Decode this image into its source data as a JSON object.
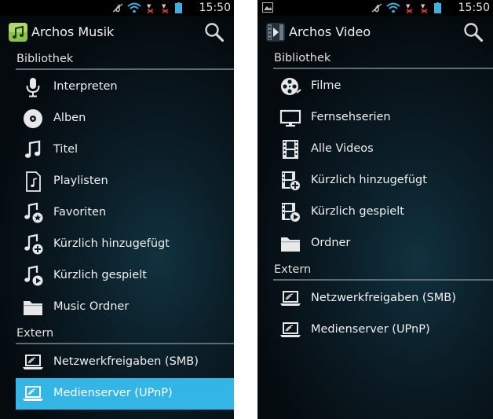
{
  "status": {
    "time": "15:50"
  },
  "left": {
    "app_title": "Archos Musik",
    "sections": [
      {
        "label": "Bibliothek",
        "items": [
          {
            "label": "Interpreten",
            "icon": "microphone-icon"
          },
          {
            "label": "Alben",
            "icon": "disc-icon"
          },
          {
            "label": "Titel",
            "icon": "music-note-icon"
          },
          {
            "label": "Playlisten",
            "icon": "playlist-file-icon"
          },
          {
            "label": "Favoriten",
            "icon": "note-star-icon"
          },
          {
            "label": "Kürzlich hinzugefügt",
            "icon": "note-plus-icon"
          },
          {
            "label": "Kürzlich gespielt",
            "icon": "note-play-icon"
          },
          {
            "label": "Music Ordner",
            "icon": "folder-icon"
          }
        ]
      },
      {
        "label": "Extern",
        "items": [
          {
            "label": "Netzwerkfreigaben (SMB)",
            "icon": "laptop-network-icon"
          },
          {
            "label": "Medienserver (UPnP)",
            "icon": "laptop-network-icon",
            "selected": true
          }
        ]
      }
    ]
  },
  "right": {
    "app_title": "Archos Video",
    "sections": [
      {
        "label": "Bibliothek",
        "items": [
          {
            "label": "Filme",
            "icon": "film-reel-icon"
          },
          {
            "label": "Fernsehserien",
            "icon": "tv-icon"
          },
          {
            "label": "Alle Videos",
            "icon": "film-strip-icon"
          },
          {
            "label": "Kürzlich hinzugefügt",
            "icon": "film-plus-icon"
          },
          {
            "label": "Kürzlich gespielt",
            "icon": "film-play-icon"
          },
          {
            "label": "Ordner",
            "icon": "folder-icon"
          }
        ]
      },
      {
        "label": "Extern",
        "items": [
          {
            "label": "Netzwerkfreigaben (SMB)",
            "icon": "laptop-network-icon"
          },
          {
            "label": "Medienserver (UPnP)",
            "icon": "laptop-network-icon"
          }
        ]
      }
    ]
  },
  "colors": {
    "selection": "#33b5e5",
    "background": "#0b1d26",
    "section_rule": "#5d6c73"
  }
}
